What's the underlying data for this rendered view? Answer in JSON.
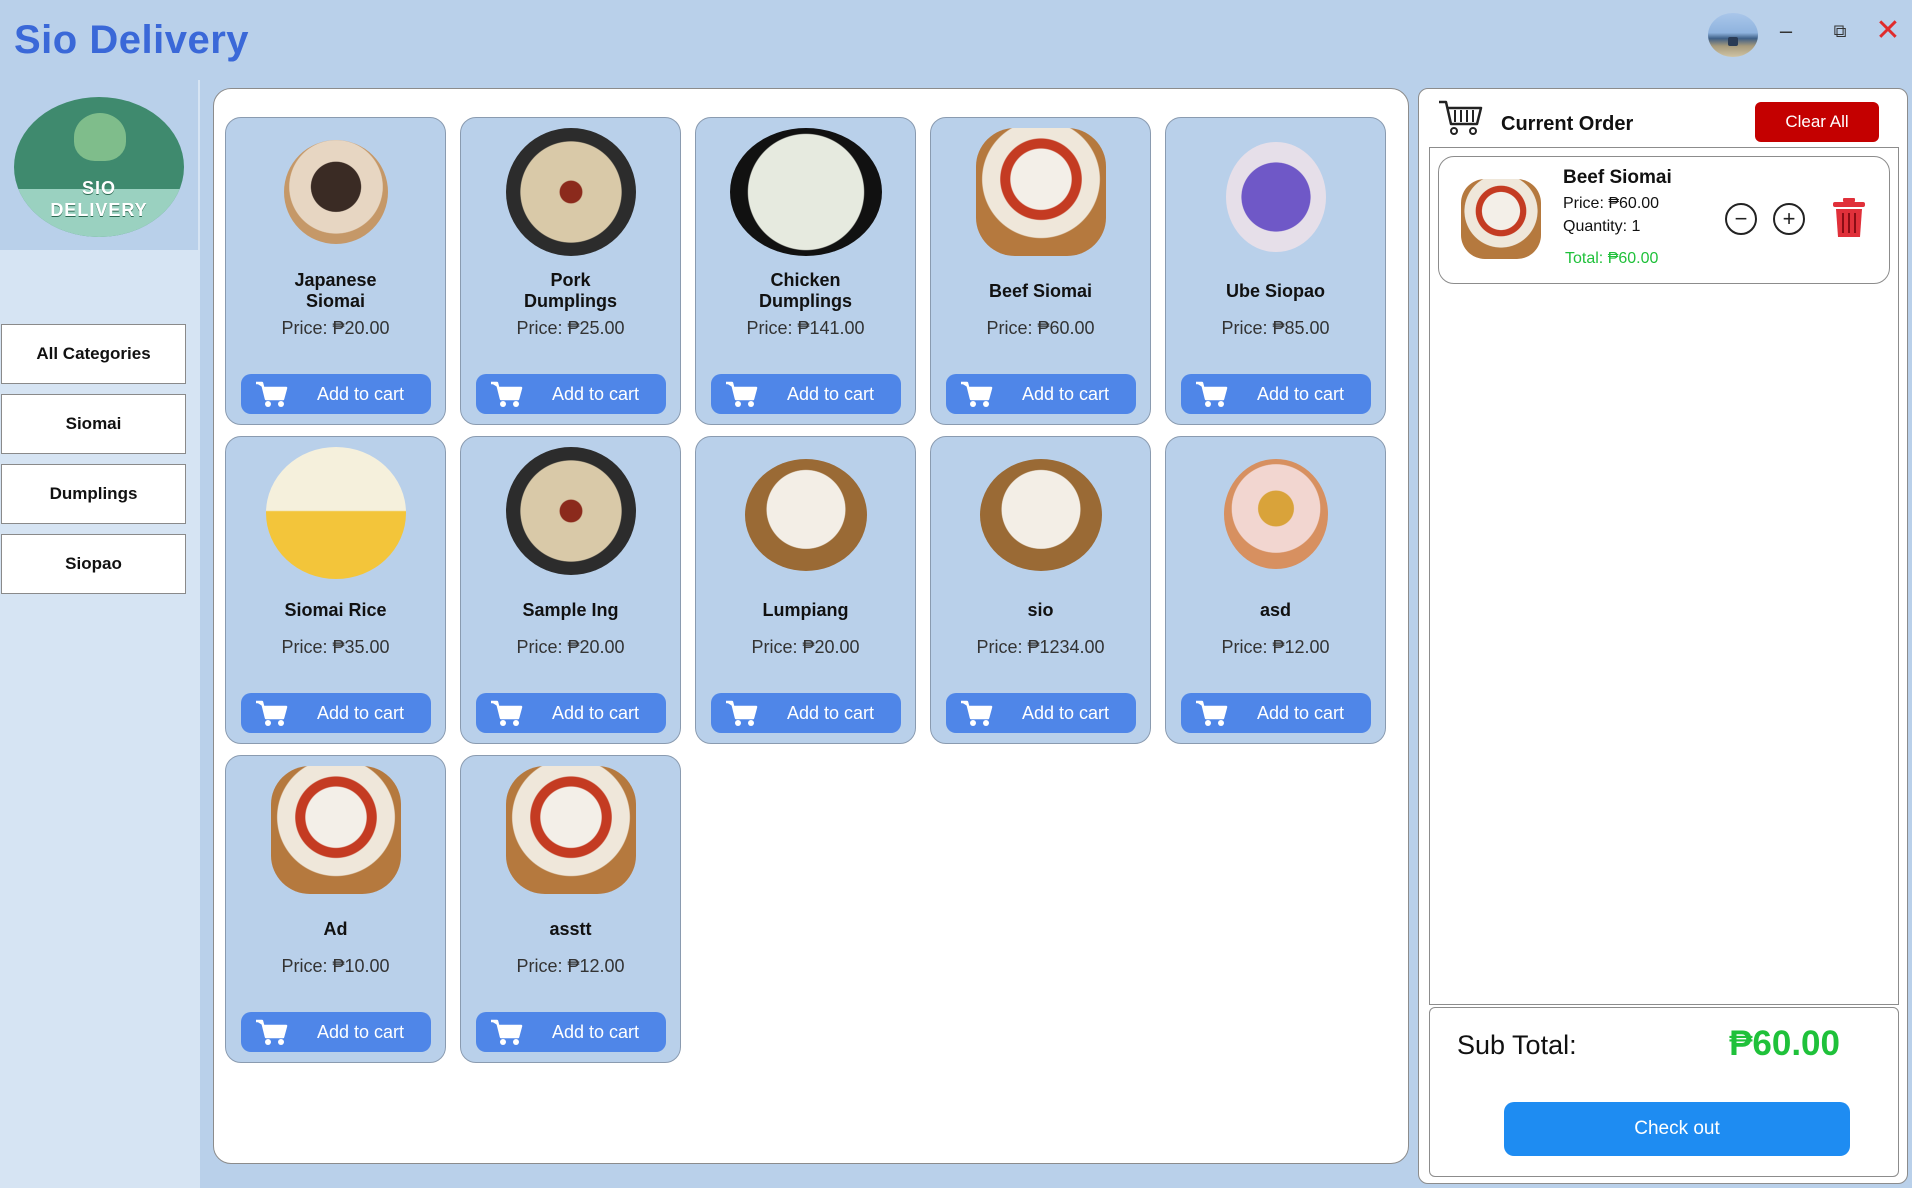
{
  "app": {
    "title": "Sio Delivery"
  },
  "logo": {
    "line1": "SIO",
    "line2": "DELIVERY"
  },
  "window_controls": {
    "minimize": "–",
    "maximize": "⧉",
    "close": "✕"
  },
  "sidebar": {
    "categories": [
      {
        "label": "All Categories"
      },
      {
        "label": "Siomai"
      },
      {
        "label": "Dumplings"
      },
      {
        "label": "Siopao"
      }
    ]
  },
  "products": [
    {
      "name": "Japanese\nSiomai",
      "price": "Price: ₱20.00",
      "image": "japanese-siomai-icon"
    },
    {
      "name": "Pork\nDumplings",
      "price": "Price: ₱25.00",
      "image": "pork-dumplings-icon"
    },
    {
      "name": "Chicken\nDumplings",
      "price": "Price: ₱141.00",
      "image": "chicken-dumplings-icon"
    },
    {
      "name": "Beef Siomai",
      "price": "Price: ₱60.00",
      "image": "beef-siomai-icon"
    },
    {
      "name": "Ube Siopao",
      "price": "Price: ₱85.00",
      "image": "ube-siopao-icon"
    },
    {
      "name": "Siomai Rice",
      "price": "Price: ₱35.00",
      "image": "siomai-rice-icon"
    },
    {
      "name": "Sample Ing",
      "price": "Price: ₱20.00",
      "image": "pork-dumplings-icon"
    },
    {
      "name": "Lumpiang",
      "price": "Price: ₱20.00",
      "image": "steamed-buns-icon"
    },
    {
      "name": "sio",
      "price": "Price: ₱1234.00",
      "image": "steamed-buns-icon"
    },
    {
      "name": "asd",
      "price": "Price: ₱12.00",
      "image": "siomai-basket-icon"
    },
    {
      "name": "Ad",
      "price": "Price: ₱10.00",
      "image": "beef-siomai-icon"
    },
    {
      "name": "asstt",
      "price": "Price: ₱12.00",
      "image": "beef-siomai-icon"
    }
  ],
  "add_to_cart_label": "Add to cart",
  "order": {
    "title": "Current Order",
    "clear_label": "Clear All",
    "items": [
      {
        "name": "Beef Siomai",
        "price": "Price: ₱60.00",
        "quantity": "Quantity: 1",
        "total": "Total: ₱60.00"
      }
    ],
    "minus_symbol": "−",
    "plus_symbol": "+",
    "subtotal_label": "Sub Total:",
    "subtotal_value": "₱60.00",
    "checkout_label": "Check out"
  },
  "colors": {
    "accent": "#3a68d8",
    "button_blue": "#4f86e8",
    "clear_red": "#c40000",
    "total_green": "#1fc13a",
    "checkout_blue": "#1e8cf2"
  }
}
